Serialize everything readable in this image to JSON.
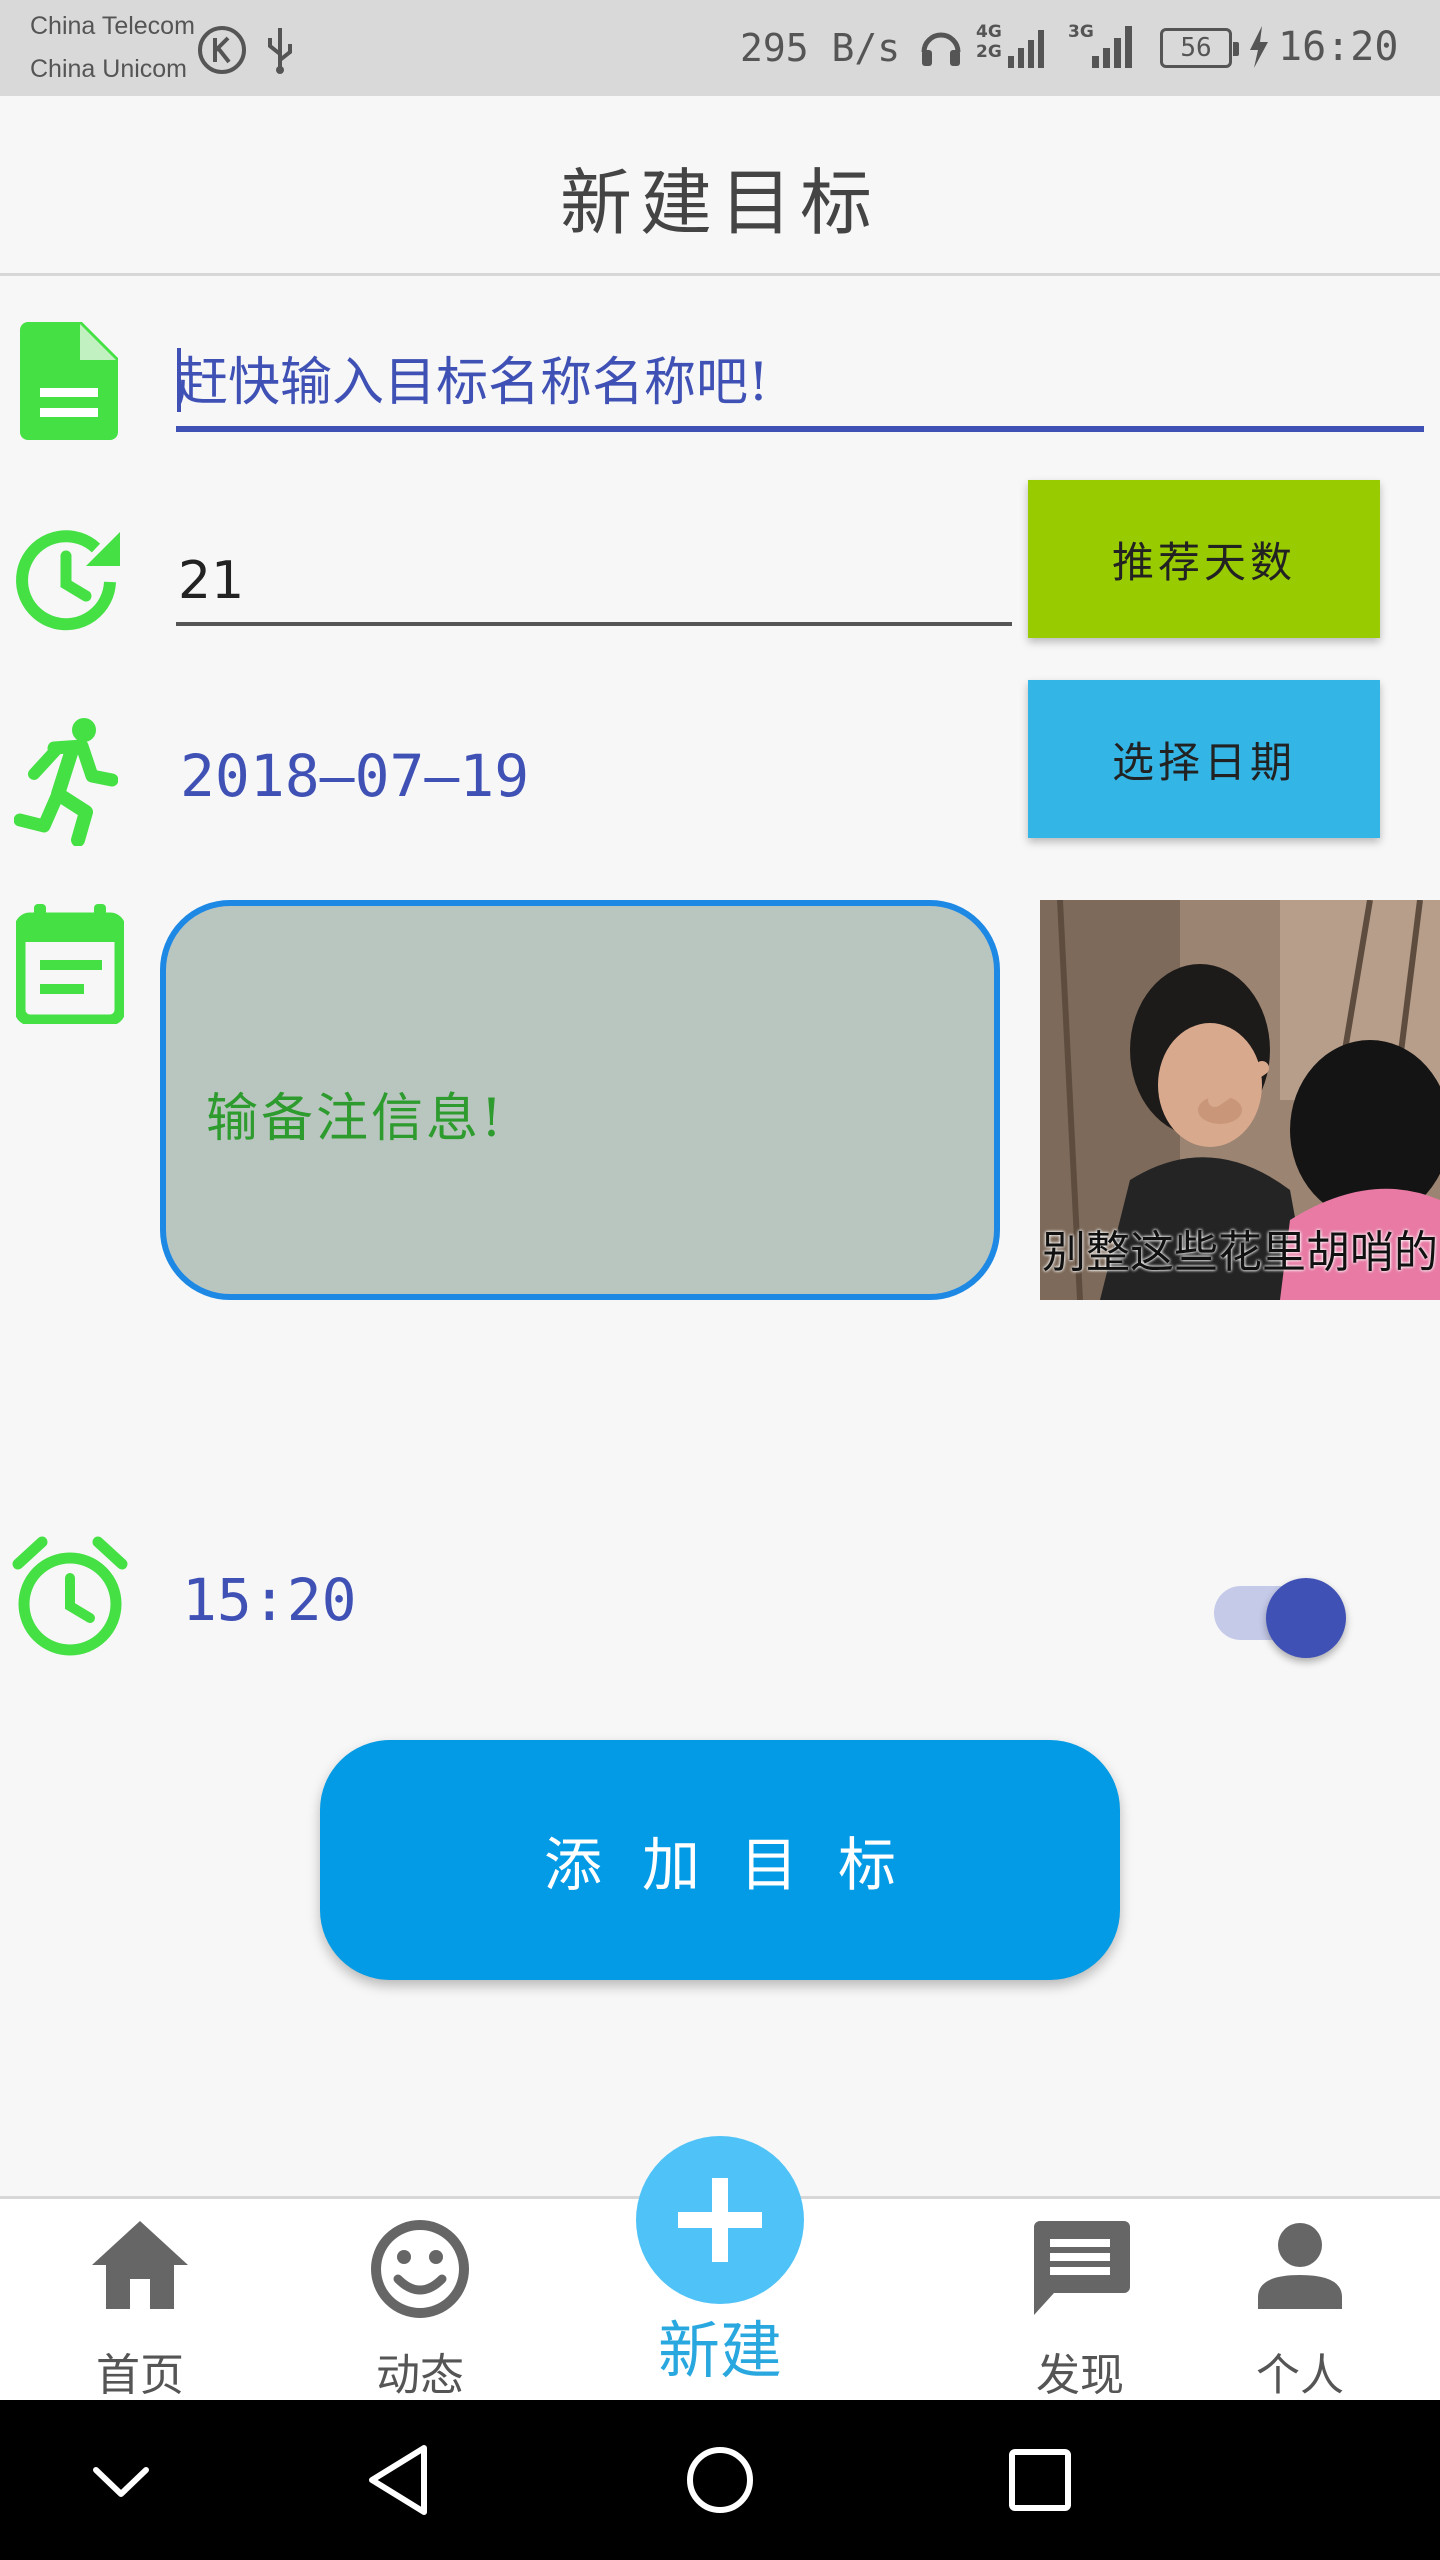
{
  "status_bar": {
    "carrier_1": "China Telecom",
    "carrier_2": "China Unicom",
    "net_speed": "295 B/s",
    "signal_1": "4G 2G",
    "signal_2": "3G",
    "battery": "56",
    "time": "16:20",
    "icons": [
      "k-circle-icon",
      "usb-icon",
      "headphones-icon",
      "signal-icon",
      "signal-icon",
      "battery-icon",
      "charging-icon"
    ]
  },
  "header": {
    "title": "新建目标"
  },
  "form": {
    "name_placeholder": "赶快输入目标名称名称吧!",
    "days_value": "21",
    "recommend_days_label": "推荐天数",
    "start_date": "2018—07—19",
    "choose_date_label": "选择日期",
    "note_placeholder": "输备注信息!",
    "image_caption": "别整这些花里胡哨的",
    "alarm_time": "15:20",
    "alarm_enabled": true,
    "add_button_label": "添加目标"
  },
  "bottom_nav": {
    "items": [
      {
        "label": "首页",
        "icon": "home-icon"
      },
      {
        "label": "动态",
        "icon": "smiley-icon"
      },
      {
        "label": "新建",
        "icon": "plus-icon"
      },
      {
        "label": "发现",
        "icon": "chat-icon"
      },
      {
        "label": "个人",
        "icon": "person-icon"
      }
    ]
  },
  "colors": {
    "accent": "#3f51b5",
    "icon_green": "#44e044",
    "recommend_button": "#99cc00",
    "date_button": "#33b5e5",
    "add_button": "#039be5",
    "note_border": "#1e88e5"
  }
}
